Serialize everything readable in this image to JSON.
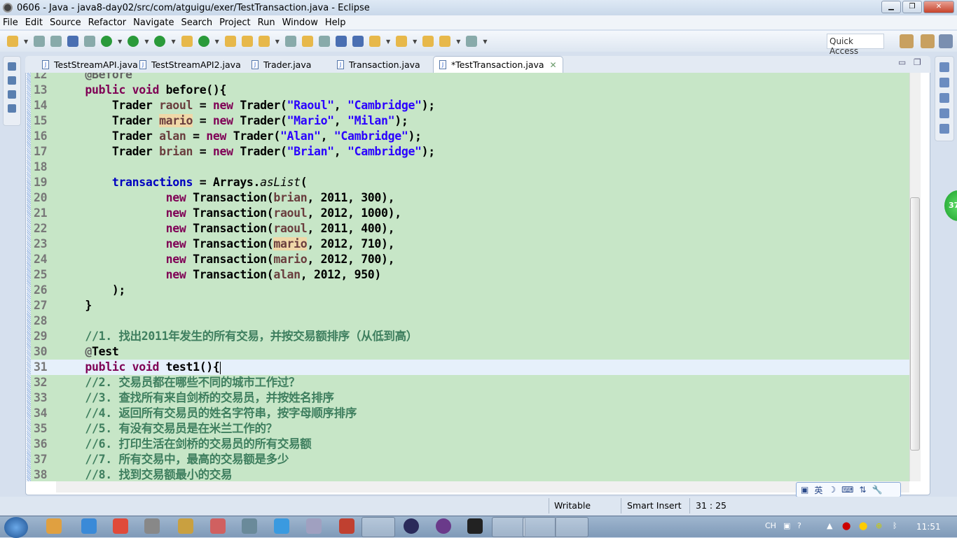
{
  "window": {
    "title": "0606 - Java - java8-day02/src/com/atguigu/exer/TestTransaction.java - Eclipse"
  },
  "menu": [
    "File",
    "Edit",
    "Source",
    "Refactor",
    "Navigate",
    "Search",
    "Project",
    "Run",
    "Window",
    "Help"
  ],
  "toolbar": {
    "quick_access": "Quick Access"
  },
  "tabs": [
    {
      "label": "TestStreamAPI.java",
      "active": false
    },
    {
      "label": "TestStreamAPI2.java",
      "active": false
    },
    {
      "label": "Trader.java",
      "active": false
    },
    {
      "label": "Transaction.java",
      "active": false
    },
    {
      "label": "*TestTransaction.java",
      "active": true
    }
  ],
  "editor": {
    "current_line": 31,
    "colors": {
      "background": "#c7e6c7",
      "keyword": "#7f0055",
      "string": "#2a00ff",
      "local": "#6a3e3e",
      "field": "#0000c0",
      "comment": "#3f7f5f"
    },
    "lines": [
      {
        "n": 12,
        "t": [
          [
            "ann",
            "    @Before"
          ]
        ]
      },
      {
        "n": 13,
        "t": [
          [
            "",
            "    "
          ],
          [
            "kw",
            "public"
          ],
          [
            "",
            " "
          ],
          [
            "kw",
            "void"
          ],
          [
            "",
            " before(){"
          ]
        ]
      },
      {
        "n": 14,
        "t": [
          [
            "",
            "        Trader "
          ],
          [
            "var",
            "raoul"
          ],
          [
            "",
            " = "
          ],
          [
            "kw",
            "new"
          ],
          [
            "",
            " Trader("
          ],
          [
            "str",
            "\"Raoul\""
          ],
          [
            "",
            ", "
          ],
          [
            "str",
            "\"Cambridge\""
          ],
          [
            "",
            ");"
          ]
        ]
      },
      {
        "n": 15,
        "t": [
          [
            "",
            "        Trader "
          ],
          [
            "var hl",
            "mario"
          ],
          [
            "",
            " = "
          ],
          [
            "kw",
            "new"
          ],
          [
            "",
            " Trader("
          ],
          [
            "str",
            "\"Mario\""
          ],
          [
            "",
            ", "
          ],
          [
            "str",
            "\"Milan\""
          ],
          [
            "",
            ");"
          ]
        ]
      },
      {
        "n": 16,
        "t": [
          [
            "",
            "        Trader "
          ],
          [
            "var",
            "alan"
          ],
          [
            "",
            " = "
          ],
          [
            "kw",
            "new"
          ],
          [
            "",
            " Trader("
          ],
          [
            "str",
            "\"Alan\""
          ],
          [
            "",
            ", "
          ],
          [
            "str",
            "\"Cambridge\""
          ],
          [
            "",
            ");"
          ]
        ]
      },
      {
        "n": 17,
        "t": [
          [
            "",
            "        Trader "
          ],
          [
            "var",
            "brian"
          ],
          [
            "",
            " = "
          ],
          [
            "kw",
            "new"
          ],
          [
            "",
            " Trader("
          ],
          [
            "str",
            "\"Brian\""
          ],
          [
            "",
            ", "
          ],
          [
            "str",
            "\"Cambridge\""
          ],
          [
            "",
            ");"
          ]
        ]
      },
      {
        "n": 18,
        "t": []
      },
      {
        "n": 19,
        "t": [
          [
            "",
            "        "
          ],
          [
            "fld",
            "transactions"
          ],
          [
            "",
            " = Arrays."
          ],
          [
            "it",
            "asList"
          ],
          [
            "",
            "("
          ]
        ]
      },
      {
        "n": 20,
        "t": [
          [
            "",
            "                "
          ],
          [
            "kw",
            "new"
          ],
          [
            "",
            " Transaction("
          ],
          [
            "var",
            "brian"
          ],
          [
            "",
            ", 2011, 300),"
          ]
        ]
      },
      {
        "n": 21,
        "t": [
          [
            "",
            "                "
          ],
          [
            "kw",
            "new"
          ],
          [
            "",
            " Transaction("
          ],
          [
            "var",
            "raoul"
          ],
          [
            "",
            ", 2012, 1000),"
          ]
        ]
      },
      {
        "n": 22,
        "t": [
          [
            "",
            "                "
          ],
          [
            "kw",
            "new"
          ],
          [
            "",
            " Transaction("
          ],
          [
            "var",
            "raoul"
          ],
          [
            "",
            ", 2011, 400),"
          ]
        ]
      },
      {
        "n": 23,
        "t": [
          [
            "",
            "                "
          ],
          [
            "kw",
            "new"
          ],
          [
            "",
            " Transaction("
          ],
          [
            "var hl",
            "mario"
          ],
          [
            "",
            ", 2012, 710),"
          ]
        ]
      },
      {
        "n": 24,
        "t": [
          [
            "",
            "                "
          ],
          [
            "kw",
            "new"
          ],
          [
            "",
            " Transaction("
          ],
          [
            "var",
            "mario"
          ],
          [
            "",
            ", 2012, 700),"
          ]
        ]
      },
      {
        "n": 25,
        "t": [
          [
            "",
            "                "
          ],
          [
            "kw",
            "new"
          ],
          [
            "",
            " Transaction("
          ],
          [
            "var",
            "alan"
          ],
          [
            "",
            ", 2012, 950)"
          ]
        ]
      },
      {
        "n": 26,
        "t": [
          [
            "",
            "        );"
          ]
        ]
      },
      {
        "n": 27,
        "t": [
          [
            "",
            "    }"
          ]
        ]
      },
      {
        "n": 28,
        "t": []
      },
      {
        "n": 29,
        "t": [
          [
            "",
            "    "
          ],
          [
            "cm",
            "//1. 找出2011年发生的所有交易，并按交易额排序（从低到高）"
          ]
        ]
      },
      {
        "n": 30,
        "t": [
          [
            "",
            "    "
          ],
          [
            "ann",
            "@"
          ],
          [
            "",
            "Test"
          ]
        ]
      },
      {
        "n": 31,
        "t": [
          [
            "",
            "    "
          ],
          [
            "kw",
            "public"
          ],
          [
            "",
            " "
          ],
          [
            "kw",
            "void"
          ],
          [
            "",
            " test1(){"
          ]
        ]
      },
      {
        "n": 32,
        "t": [
          [
            "",
            "    "
          ],
          [
            "cm",
            "//2. 交易员都在哪些不同的城市工作过？"
          ]
        ]
      },
      {
        "n": 33,
        "t": [
          [
            "",
            "    "
          ],
          [
            "cm",
            "//3. 查找所有来自剑桥的交易员，并按姓名排序"
          ]
        ]
      },
      {
        "n": 34,
        "t": [
          [
            "",
            "    "
          ],
          [
            "cm",
            "//4. 返回所有交易员的姓名字符串，按字母顺序排序"
          ]
        ]
      },
      {
        "n": 35,
        "t": [
          [
            "",
            "    "
          ],
          [
            "cm",
            "//5. 有没有交易员是在米兰工作的？"
          ]
        ]
      },
      {
        "n": 36,
        "t": [
          [
            "",
            "    "
          ],
          [
            "cm",
            "//6. 打印生活在剑桥的交易员的所有交易额"
          ]
        ]
      },
      {
        "n": 37,
        "t": [
          [
            "",
            "    "
          ],
          [
            "cm",
            "//7. 所有交易中，最高的交易额是多少"
          ]
        ]
      },
      {
        "n": 38,
        "t": [
          [
            "",
            "    "
          ],
          [
            "cm",
            "//8. 找到交易额最小的交易"
          ]
        ]
      }
    ]
  },
  "notification_badge": "37",
  "ime": {
    "mode": "英"
  },
  "status": {
    "writable": "Writable",
    "insert_mode": "Smart Insert",
    "position": "31 : 25"
  },
  "taskbar": {
    "tray_lang": "CH",
    "clock": "11:51"
  }
}
